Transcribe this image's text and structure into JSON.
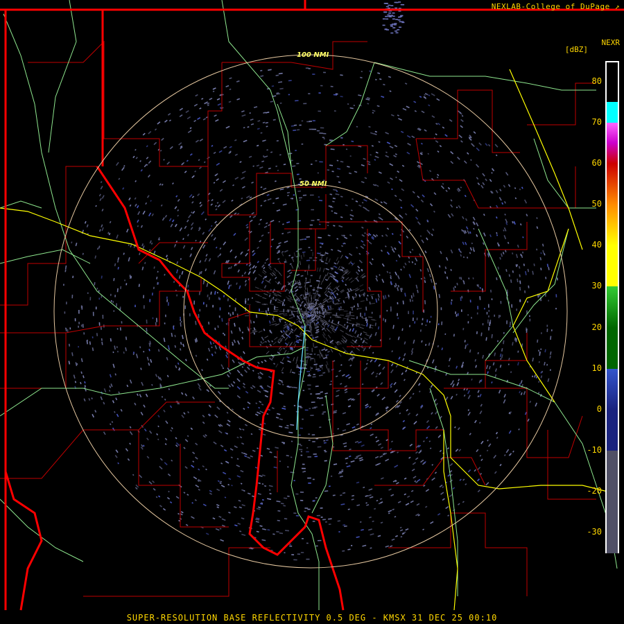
{
  "header": {
    "credit": "NEXLAB-College of DuPage",
    "credit_icon": "external-link-icon"
  },
  "legend": {
    "product": "NEXR",
    "units": "[dBZ]",
    "ticks": [
      "80",
      "70",
      "60",
      "50",
      "40",
      "30",
      "20",
      "10",
      "0",
      "-10",
      "-20",
      "-30"
    ],
    "tick_values": [
      80,
      70,
      60,
      50,
      40,
      30,
      20,
      10,
      0,
      -10,
      -20,
      -30
    ],
    "range": [
      -35,
      85
    ],
    "color_stops": [
      {
        "from": 75,
        "to": 85,
        "color": "#000000"
      },
      {
        "from": 70,
        "to": 75,
        "color": "#00ffff"
      },
      {
        "from": 65,
        "to": 70,
        "color": "#ff66ff"
      },
      {
        "from": 60,
        "to": 65,
        "color": "#cc00cc"
      },
      {
        "from": 50,
        "to": 60,
        "color": "#cc0000"
      },
      {
        "from": 40,
        "to": 50,
        "color": "#ff8c00"
      },
      {
        "from": 30,
        "to": 40,
        "color": "#ffff00"
      },
      {
        "from": 20,
        "to": 30,
        "color": "#33cc33"
      },
      {
        "from": 10,
        "to": 20,
        "color": "#006600"
      },
      {
        "from": 0,
        "to": 10,
        "color": "#3355cc"
      },
      {
        "from": -10,
        "to": 0,
        "color": "#1a237e"
      },
      {
        "from": -35,
        "to": -10,
        "color": "#505066"
      }
    ]
  },
  "range_rings": {
    "inner_label": "50 NMI",
    "outer_label": "100 NMI",
    "color": "#e6c8a0"
  },
  "colors": {
    "state_border": "#ff0000",
    "county_border": "#cc0000",
    "highway": "#99ff99",
    "interstate": "#ffff00",
    "echo": "#7a7fb0"
  },
  "footer": {
    "text": "SUPER-RESOLUTION BASE REFLECTIVITY 0.5 DEG - KMSX 31 DEC 25 00:10"
  }
}
